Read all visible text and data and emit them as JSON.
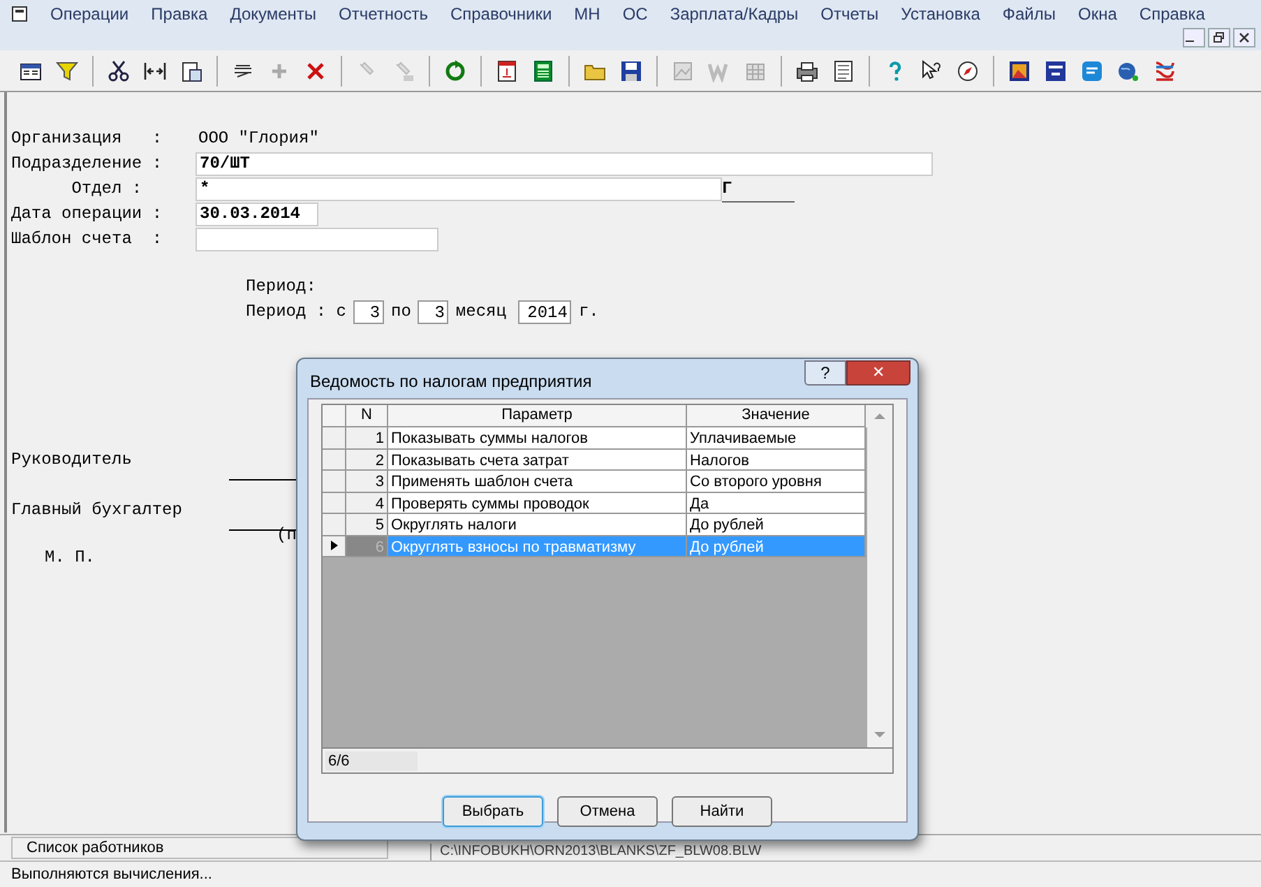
{
  "menu": [
    "Операции",
    "Правка",
    "Документы",
    "Отчетность",
    "Справочники",
    "МН",
    "ОС",
    "Зарплата/Кадры",
    "Отчеты",
    "Установка",
    "Файлы",
    "Окна",
    "Справка"
  ],
  "form": {
    "fields": [
      {
        "label": "Организация   :",
        "value": "ООО \"Глория\"",
        "kind": "text"
      },
      {
        "label": "Подразделение :",
        "value": "70/ШТ",
        "kind": "input"
      },
      {
        "label": "      Отдел :",
        "value": "*",
        "kind": "input",
        "suffix": "Г"
      },
      {
        "label": "Дата операции :",
        "value": "30.03.2014",
        "kind": "input"
      },
      {
        "label": "Шаблон счета  :",
        "kind": "input"
      }
    ],
    "period_title": "Период:",
    "period": {
      "label": "Период : с",
      "from": "3",
      "to_label": "по",
      "to": "3",
      "month_label": "месяц",
      "year": "2014",
      "year_suffix": "г."
    },
    "signatures": [
      {
        "label": "Руководитель"
      },
      {
        "label": "Главный бухгалтер"
      }
    ],
    "sign_hint": "(п",
    "stamp": "М. П."
  },
  "dialog": {
    "title": "Ведомость по налогам предприятия",
    "help": "?",
    "close": "✕",
    "columns": [
      "N",
      "Параметр",
      "Значение"
    ],
    "rows": [
      {
        "n": "1",
        "param": "Показывать суммы налогов",
        "value": "Уплачиваемые",
        "selected": false
      },
      {
        "n": "2",
        "param": "Показывать счета затрат",
        "value": "Налогов",
        "selected": false
      },
      {
        "n": "3",
        "param": "Применять шаблон счета",
        "value": "Со второго уровня",
        "selected": false
      },
      {
        "n": "4",
        "param": "Проверять суммы проводок",
        "value": "Да",
        "selected": false
      },
      {
        "n": "5",
        "param": "Округлять налоги",
        "value": "До рублей",
        "selected": false
      },
      {
        "n": "6",
        "param": "Округлять взносы по травматизму",
        "value": "До рублей",
        "selected": true
      }
    ],
    "counter": "6/6",
    "buttons": [
      {
        "label": "Выбрать",
        "default": true
      },
      {
        "label": "Отмена",
        "default": false
      },
      {
        "label": "Найти",
        "default": false
      }
    ]
  },
  "status_bar": {
    "list": "Список работников",
    "path": "C:\\INFOBUKH\\ORN2013\\BLANKS\\ZF_BLW08.BLW",
    "message": "Выполняются вычисления..."
  }
}
